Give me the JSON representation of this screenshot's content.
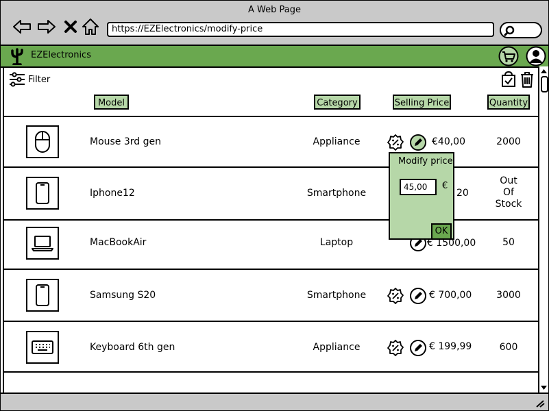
{
  "window": {
    "title": "A Web Page"
  },
  "browser": {
    "url": "https://EZElectronics/modify-price"
  },
  "app": {
    "name": "EZElectronics"
  },
  "toolbar": {
    "filter_label": "Filter"
  },
  "columns": {
    "model": "Model",
    "category": "Category",
    "selling_price": "Selling Price",
    "quantity": "Quantity"
  },
  "rows": [
    {
      "model": "Mouse 3rd gen",
      "category": "Appliance",
      "price": "€40,00",
      "quantity": "2000",
      "icon": "mouse-icon"
    },
    {
      "model": "Iphone12",
      "category": "Smartphone",
      "price": "20",
      "quantity_lines": [
        "Out",
        "Of",
        "Stock"
      ],
      "icon": "smartphone-icon"
    },
    {
      "model": "MacBookAir",
      "category": "Laptop",
      "price": "€ 1500,00",
      "quantity": "50",
      "icon": "laptop-icon"
    },
    {
      "model": "Samsung S20",
      "category": "Smartphone",
      "price": "€ 700,00",
      "quantity": "3000",
      "icon": "smartphone-icon"
    },
    {
      "model": "Keyboard 6th gen",
      "category": "Appliance",
      "price": "€ 199,99",
      "quantity": "600",
      "icon": "keyboard-icon"
    }
  ],
  "popup": {
    "title": "Modify price",
    "value": "45,00",
    "currency": "€",
    "ok_label": "OK"
  },
  "colors": {
    "accent": "#6aa84f",
    "header_fill": "#b6d7a8",
    "chrome": "#c9c9c9"
  }
}
